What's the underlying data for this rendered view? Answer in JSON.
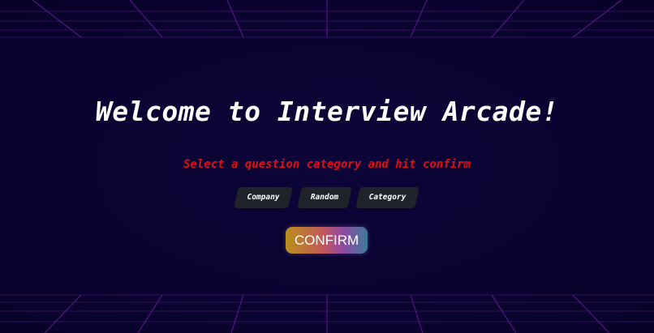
{
  "heading": "Welcome to Interview Arcade!",
  "instruction": "Select a question category and hit confirm",
  "options": [
    {
      "label": "Company"
    },
    {
      "label": "Random"
    },
    {
      "label": "Category"
    }
  ],
  "confirm_label": "CONFIRM",
  "colors": {
    "background": "#0b0432",
    "grid": "#5a1a8a",
    "instruction": "#e00d17",
    "option_bg": "#21232b"
  }
}
